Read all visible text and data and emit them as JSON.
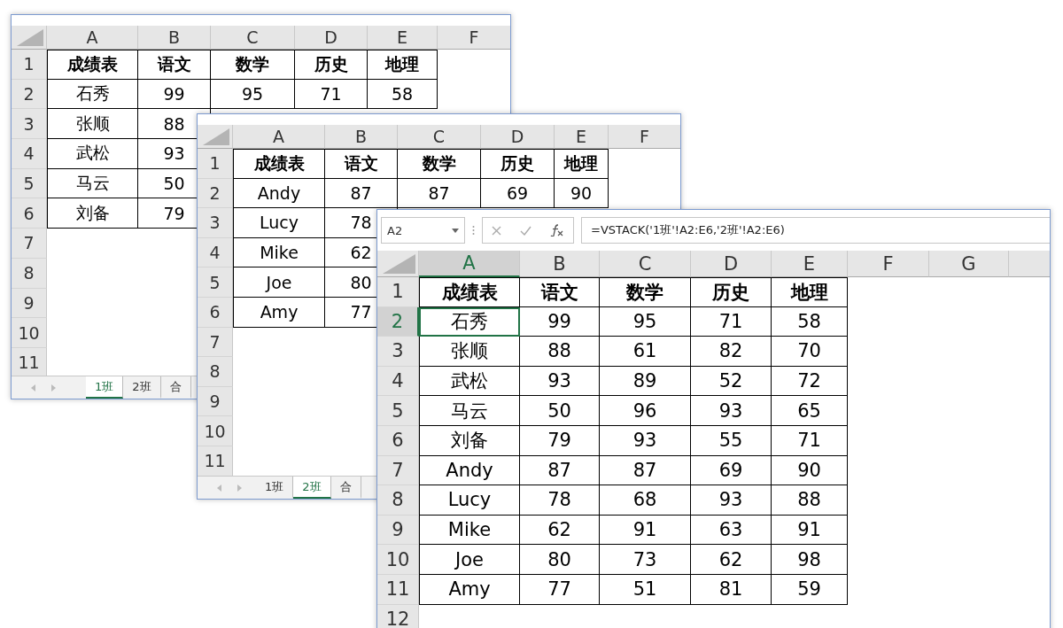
{
  "windows": [
    {
      "columns": [
        {
          "label": "A",
          "selected": false
        },
        {
          "label": "B",
          "selected": false
        },
        {
          "label": "C",
          "selected": false
        },
        {
          "label": "D",
          "selected": false
        },
        {
          "label": "E",
          "selected": false
        },
        {
          "label": "F",
          "selected": false
        }
      ],
      "rows": [
        {
          "header": "1",
          "kind": "heading",
          "selected": false,
          "cells": [
            "成绩表",
            "语文",
            "数学",
            "历史",
            "地理"
          ]
        },
        {
          "header": "2",
          "kind": "data",
          "selected": false,
          "cells": [
            "石秀",
            "99",
            "95",
            "71",
            "58"
          ]
        },
        {
          "header": "3",
          "kind": "data",
          "selected": false,
          "cells": [
            "张顺",
            "88"
          ]
        },
        {
          "header": "4",
          "kind": "data",
          "selected": false,
          "cells": [
            "武松",
            "93"
          ]
        },
        {
          "header": "5",
          "kind": "data",
          "selected": false,
          "cells": [
            "马云",
            "50"
          ]
        },
        {
          "header": "6",
          "kind": "data",
          "selected": false,
          "cells": [
            "刘备",
            "79"
          ]
        },
        {
          "header": "7",
          "kind": "data",
          "selected": false
        },
        {
          "header": "8",
          "kind": "data",
          "selected": false
        },
        {
          "header": "9",
          "kind": "data",
          "selected": false
        },
        {
          "header": "10",
          "kind": "data",
          "selected": false
        },
        {
          "header": "11",
          "kind": "data",
          "selected": false
        }
      ],
      "tabs": [
        {
          "label": "1班",
          "selected": true
        },
        {
          "label": "2班",
          "selected": false
        },
        {
          "label": "合",
          "selected": false
        }
      ]
    },
    {
      "columns": [
        {
          "label": "A",
          "selected": false
        },
        {
          "label": "B",
          "selected": false
        },
        {
          "label": "C",
          "selected": false
        },
        {
          "label": "D",
          "selected": false
        },
        {
          "label": "E",
          "selected": false
        },
        {
          "label": "F",
          "selected": false
        }
      ],
      "rows": [
        {
          "header": "1",
          "kind": "heading",
          "selected": false,
          "cells": [
            "成绩表",
            "语文",
            "数学",
            "历史",
            "地理"
          ]
        },
        {
          "header": "2",
          "kind": "data",
          "selected": false,
          "cells": [
            "Andy",
            "87",
            "87",
            "69",
            "90"
          ]
        },
        {
          "header": "3",
          "kind": "data",
          "selected": false,
          "cells": [
            "Lucy",
            "78"
          ]
        },
        {
          "header": "4",
          "kind": "data",
          "selected": false,
          "cells": [
            "Mike",
            "62"
          ]
        },
        {
          "header": "5",
          "kind": "data",
          "selected": false,
          "cells": [
            "Joe",
            "80"
          ]
        },
        {
          "header": "6",
          "kind": "data",
          "selected": false,
          "cells": [
            "Amy",
            "77"
          ]
        },
        {
          "header": "7",
          "kind": "data",
          "selected": false
        },
        {
          "header": "8",
          "kind": "data",
          "selected": false
        },
        {
          "header": "9",
          "kind": "data",
          "selected": false
        },
        {
          "header": "10",
          "kind": "data",
          "selected": false
        },
        {
          "header": "11",
          "kind": "data",
          "selected": false
        }
      ],
      "tabs": [
        {
          "label": "1班",
          "selected": false
        },
        {
          "label": "2班",
          "selected": true
        },
        {
          "label": "合",
          "selected": false
        }
      ]
    },
    {
      "name_box": "A2",
      "formula": "=VSTACK('1班'!A2:E6,'2班'!A2:E6)",
      "columns": [
        {
          "label": "A",
          "selected": true
        },
        {
          "label": "B",
          "selected": false
        },
        {
          "label": "C",
          "selected": false
        },
        {
          "label": "D",
          "selected": false
        },
        {
          "label": "E",
          "selected": false
        },
        {
          "label": "F",
          "selected": false
        },
        {
          "label": "G",
          "selected": false
        }
      ],
      "rows": [
        {
          "header": "1",
          "kind": "heading",
          "selected": false,
          "cells": [
            "成绩表",
            "语文",
            "数学",
            "历史",
            "地理"
          ]
        },
        {
          "header": "2",
          "kind": "data",
          "selected": true,
          "cells": [
            "石秀",
            "99",
            "95",
            "71",
            "58"
          ]
        },
        {
          "header": "3",
          "kind": "data",
          "selected": false,
          "cells": [
            "张顺",
            "88",
            "61",
            "82",
            "70"
          ]
        },
        {
          "header": "4",
          "kind": "data",
          "selected": false,
          "cells": [
            "武松",
            "93",
            "89",
            "52",
            "72"
          ]
        },
        {
          "header": "5",
          "kind": "data",
          "selected": false,
          "cells": [
            "马云",
            "50",
            "96",
            "93",
            "65"
          ]
        },
        {
          "header": "6",
          "kind": "data",
          "selected": false,
          "cells": [
            "刘备",
            "79",
            "93",
            "55",
            "71"
          ]
        },
        {
          "header": "7",
          "kind": "data",
          "selected": false,
          "cells": [
            "Andy",
            "87",
            "87",
            "69",
            "90"
          ]
        },
        {
          "header": "8",
          "kind": "data",
          "selected": false,
          "cells": [
            "Lucy",
            "78",
            "68",
            "93",
            "88"
          ]
        },
        {
          "header": "9",
          "kind": "data",
          "selected": false,
          "cells": [
            "Mike",
            "62",
            "91",
            "63",
            "91"
          ]
        },
        {
          "header": "10",
          "kind": "data",
          "selected": false,
          "cells": [
            "Joe",
            "80",
            "73",
            "62",
            "98"
          ]
        },
        {
          "header": "11",
          "kind": "data",
          "selected": false,
          "cells": [
            "Amy",
            "77",
            "51",
            "81",
            "59"
          ]
        },
        {
          "header": "12",
          "kind": "data",
          "selected": false
        }
      ]
    }
  ]
}
